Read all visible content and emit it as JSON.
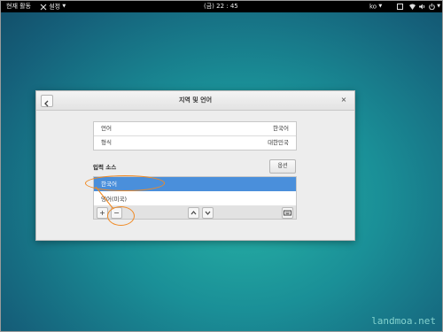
{
  "topbar": {
    "activities": "현재 활동",
    "settings_menu": "설정",
    "clock": "(금) 22 : 45",
    "input_lang": "ko"
  },
  "dialog": {
    "title": "지역 및 언어",
    "close": "×",
    "rows": [
      {
        "label": "언어",
        "value": "한국어"
      },
      {
        "label": "형식",
        "value": "대한민국"
      }
    ],
    "section_label": "입력 소스",
    "options_button": "옵션",
    "sources": [
      "한국어",
      "영어(미국)"
    ],
    "toolbar": {
      "add": "+",
      "remove": "−"
    }
  },
  "colors": {
    "selection": "#4a8fdb",
    "annotation": "#f08a24"
  },
  "watermark": "landmoa.net"
}
